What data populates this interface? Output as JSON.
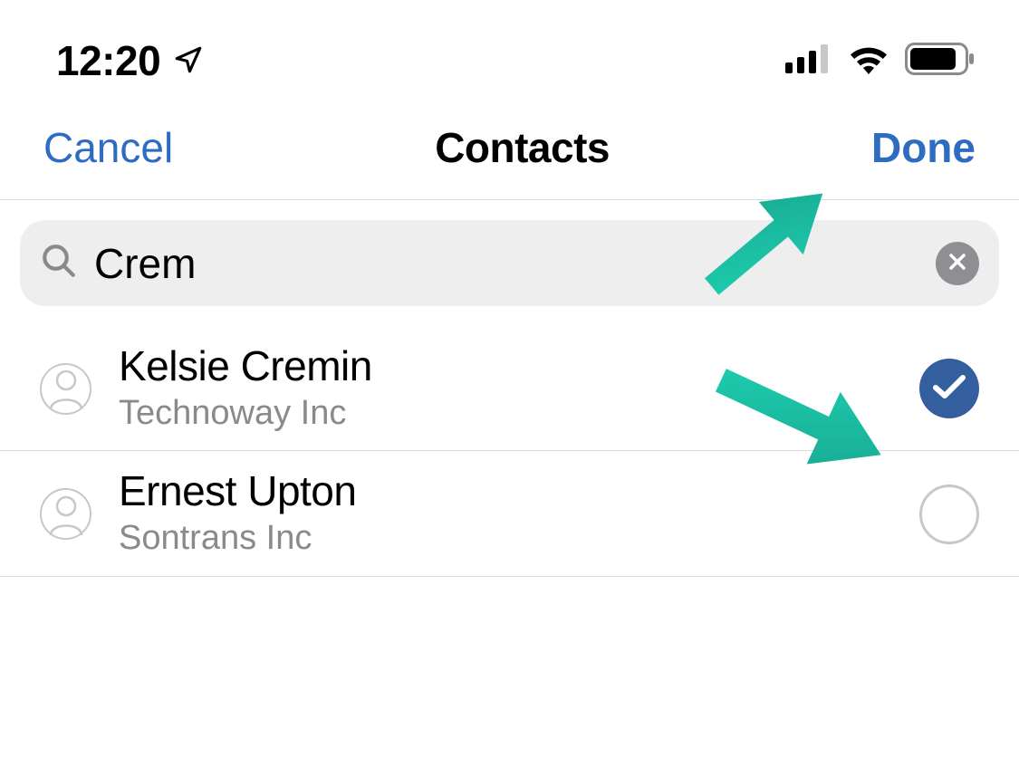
{
  "status": {
    "time": "12:20"
  },
  "nav": {
    "cancel": "Cancel",
    "title": "Contacts",
    "done": "Done"
  },
  "search": {
    "value": "Crem"
  },
  "contacts": [
    {
      "name": "Kelsie Cremin",
      "company": "Technoway Inc",
      "selected": true
    },
    {
      "name": "Ernest Upton",
      "company": "Sontrans Inc",
      "selected": false
    }
  ]
}
